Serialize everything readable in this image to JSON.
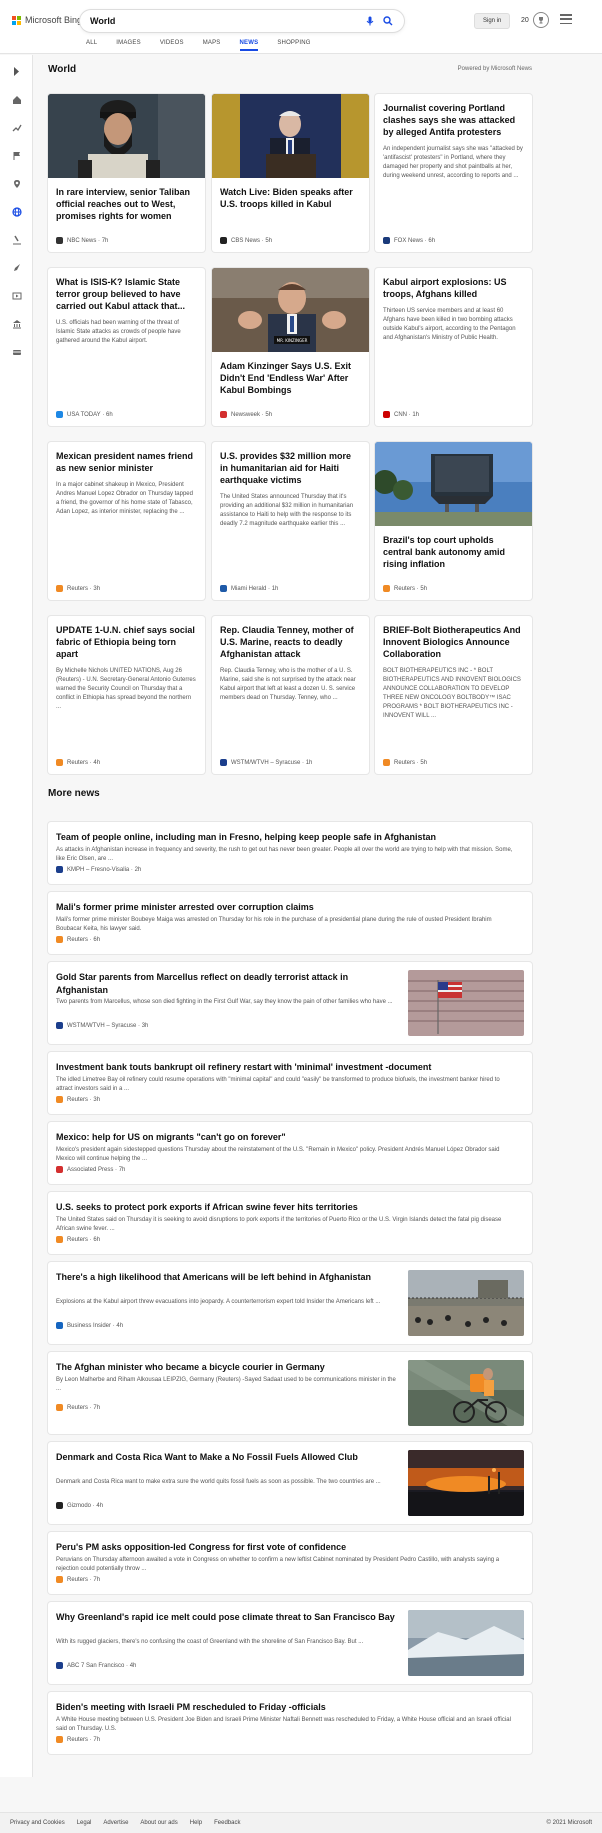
{
  "header": {
    "logo_text": "Microsoft Bing",
    "search_value": "World",
    "signin_label": "Sign in",
    "rewards_count": "20"
  },
  "tabs": [
    "ALL",
    "IMAGES",
    "VIDEOS",
    "MAPS",
    "NEWS",
    "SHOPPING"
  ],
  "active_tab": "NEWS",
  "section": {
    "title": "World",
    "powered": "Powered by Microsoft News"
  },
  "cards": [
    {
      "title": "In rare interview, senior Taliban official reaches out to West, promises rights for women",
      "snippet": "",
      "source": "NBC News",
      "time": "7h",
      "icon_color": "#333333",
      "image": "taliban"
    },
    {
      "title": "Watch Live: Biden speaks after U.S. troops killed in Kabul",
      "snippet": "",
      "source": "CBS News",
      "time": "5h",
      "icon_color": "#222222",
      "image": "biden"
    },
    {
      "title": "Journalist covering Portland clashes says she was attacked by alleged Antifa protesters",
      "snippet": "An independent journalist says she was \"attacked by 'antifascist' protesters\" in Portland, where they damaged her property and shot paintballs at her, during weekend unrest, according to reports and ...",
      "source": "FOX News",
      "time": "6h",
      "icon_color": "#1a3a7a",
      "image": ""
    },
    {
      "title": "What is ISIS-K? Islamic State terror group believed to have carried out Kabul attack that...",
      "snippet": "U.S. officials had been warning of the threat of Islamic State attacks as crowds of people have gathered around the Kabul airport.",
      "source": "USA TODAY",
      "time": "6h",
      "icon_color": "#1e88e5",
      "image": ""
    },
    {
      "title": "Adam Kinzinger Says U.S. Exit Didn't End 'Endless War' After Kabul Bombings",
      "snippet": "",
      "source": "Newsweek",
      "time": "5h",
      "icon_color": "#d32f2f",
      "image": "kinzinger"
    },
    {
      "title": "Kabul airport explosions: US troops, Afghans killed",
      "snippet": "Thirteen US service members and at least 60 Afghans have been killed in two bombing attacks outside Kabul's airport, according to the Pentagon and Afghanistan's Ministry of Public Health.",
      "source": "CNN",
      "time": "1h",
      "icon_color": "#cc0000",
      "image": ""
    },
    {
      "title": "Mexican president names friend as new senior minister",
      "snippet": "In a major cabinet shakeup in Mexico, President Andres Manuel Lopez Obrador on Thursday tapped a friend, the governor of his home state of Tabasco, Adan Lopez, as interior minister, replacing the ...",
      "source": "Reuters",
      "time": "3h",
      "icon_color": "#f08a24",
      "image": ""
    },
    {
      "title": "U.S. provides $32 million more in humanitarian aid for Haiti earthquake victims",
      "snippet": "The United States announced Thursday that it's providing an additional $32 million in humanitarian assistance to Haiti to help with the response to its deadly 7.2 magnitude earthquake earlier this ...",
      "source": "Miami Herald",
      "time": "1h",
      "icon_color": "#1e5aa8",
      "image": ""
    },
    {
      "title": "Brazil's top court upholds central bank autonomy amid rising inflation",
      "snippet": "",
      "source": "Reuters",
      "time": "5h",
      "icon_color": "#f08a24",
      "image": "brazil"
    },
    {
      "title": "UPDATE 1-U.N. chief says social fabric of Ethiopia being torn apart",
      "snippet": "By Michelle Nichols UNITED NATIONS, Aug 26 (Reuters) - U.N. Secretary-General Antonio Guterres warned the Security Council on Thursday that a conflict in Ethiopia has spread beyond the northern ...",
      "source": "Reuters",
      "time": "4h",
      "icon_color": "#f08a24",
      "image": ""
    },
    {
      "title": "Rep. Claudia Tenney, mother of U.S. Marine, reacts to deadly Afghanistan attack",
      "snippet": "Rep. Claudia Tenney, who is the mother of a U. S. Marine, said she is not surprised by the attack near Kabul airport that left at least a dozen U. S. service members dead on Thursday. Tenney, who ...",
      "source": "WSTM/WTVH – Syracuse",
      "time": "1h",
      "icon_color": "#1b3e8c",
      "image": ""
    },
    {
      "title": "BRIEF-Bolt Biotherapeutics And Innovent Biologics Announce Collaboration",
      "snippet": "BOLT BIOTHERAPEUTICS INC - * BOLT BIOTHERAPEUTICS AND INNOVENT BIOLOGICS ANNOUNCE COLLABORATION TO DEVELOP THREE NEW ONCOLOGY BOLTBODY™ ISAC PROGRAMS * BOLT BIOTHERAPEUTICS INC - INNOVENT WILL ...",
      "source": "Reuters",
      "time": "5h",
      "icon_color": "#f08a24",
      "image": ""
    }
  ],
  "more_news_title": "More news",
  "more_news": [
    {
      "title": "Team of people online, including man in Fresno, helping keep people safe in Afghanistan",
      "snippet": "As attacks in Afghanistan increase in frequency and severity, the rush to get out has never been greater. People all over the world are trying to help with that mission. Some, like Eric Olsen, are ...",
      "source": "KMPH – Fresno-Visalia",
      "time": "2h",
      "icon_color": "#1b3e8c",
      "image": ""
    },
    {
      "title": "Mali's former prime minister arrested over corruption claims",
      "snippet": "Mali's former prime minister Boubeye Maiga was arrested on Thursday for his role in the purchase of a presidential plane during the rule of ousted President Ibrahim Boubacar Keita, his lawyer said.",
      "source": "Reuters",
      "time": "6h",
      "icon_color": "#f08a24",
      "image": ""
    },
    {
      "title": "Gold Star parents from Marcellus reflect on deadly terrorist attack in Afghanistan",
      "snippet": "Two parents from Marcellus, whose son died fighting in the First Gulf War, say they know the pain of other families who have ...",
      "source": "WSTM/WTVH – Syracuse",
      "time": "3h",
      "icon_color": "#1b3e8c",
      "image": "flag"
    },
    {
      "title": "Investment bank touts bankrupt oil refinery restart with 'minimal' investment -document",
      "snippet": "The idled Limetree Bay oil refinery could resume operations with \"minimal capital\" and could \"easily\" be transformed to produce biofuels, the investment banker hired to attract investors said in a ...",
      "source": "Reuters",
      "time": "3h",
      "icon_color": "#f08a24",
      "image": ""
    },
    {
      "title": "Mexico: help for US on migrants \"can't go on forever\"",
      "snippet": "Mexico's president again sidestepped questions Thursday about the reinstatement of the U.S. \"Remain in Mexico\" policy. President Andrés Manuel López Obrador said Mexico will continue helping the ...",
      "source": "Associated Press",
      "time": "7h",
      "icon_color": "#d32f2f",
      "image": ""
    },
    {
      "title": "U.S. seeks to protect pork exports if African swine fever hits territories",
      "snippet": "The United States said on Thursday it is seeking to avoid disruptions to pork exports if the territories of Puerto Rico or the U.S. Virgin Islands detect the fatal pig disease African swine fever. ...",
      "source": "Reuters",
      "time": "6h",
      "icon_color": "#f08a24",
      "image": ""
    },
    {
      "title": "There's a high likelihood that Americans will be left behind in Afghanistan",
      "snippet": "Explosions at the Kabul airport threw evacuations into jeopardy. A counterterrorism expert told Insider the Americans left ...",
      "source": "Business Insider",
      "time": "4h",
      "icon_color": "#1565c0",
      "image": "airport"
    },
    {
      "title": "The Afghan minister who became a bicycle courier in Germany",
      "snippet": "By Leon Malherbe and Riham Alkousaa LEIPZIG, Germany (Reuters) -Sayed Sadaat used to be communications minister in the ...",
      "source": "Reuters",
      "time": "7h",
      "icon_color": "#f08a24",
      "image": "bike"
    },
    {
      "title": "Denmark and Costa Rica Want to Make a No Fossil Fuels Allowed Club",
      "snippet": "Denmark and Costa Rica want to make extra sure the world quits fossil fuels as soon as possible. The two countries are ...",
      "source": "Gizmodo",
      "time": "4h",
      "icon_color": "#222222",
      "image": "sunset"
    },
    {
      "title": "Peru's PM asks opposition-led Congress for first vote of confidence",
      "snippet": "Peruvians on Thursday afternoon awaited a vote in Congress on whether to confirm a new leftist Cabinet nominated by President Pedro Castillo, with analysts saying a rejection could potentially throw ...",
      "source": "Reuters",
      "time": "7h",
      "icon_color": "#f08a24",
      "image": ""
    },
    {
      "title": "Why Greenland's rapid ice melt could pose climate threat to San Francisco Bay",
      "snippet": "With its rugged glaciers, there's no confusing the coast of Greenland with the shoreline of San Francisco Bay. But ...",
      "source": "ABC 7 San Francisco",
      "time": "4h",
      "icon_color": "#1b3e8c",
      "image": "ice"
    },
    {
      "title": "Biden's meeting with Israeli PM rescheduled to Friday -officials",
      "snippet": "A White House meeting between U.S. President Joe Biden and Israeli Prime Minister Naftali Bennett was rescheduled to Friday, a White House official and an Israeli official said on Thursday. U.S.",
      "source": "Reuters",
      "time": "7h",
      "icon_color": "#f08a24",
      "image": ""
    }
  ],
  "footer": {
    "links": [
      "Privacy and Cookies",
      "Legal",
      "Advertise",
      "About our ads",
      "Help",
      "Feedback"
    ],
    "copyright": "© 2021 Microsoft"
  },
  "colors": {
    "accent": "#174ae4",
    "reuters": "#f08a24"
  }
}
